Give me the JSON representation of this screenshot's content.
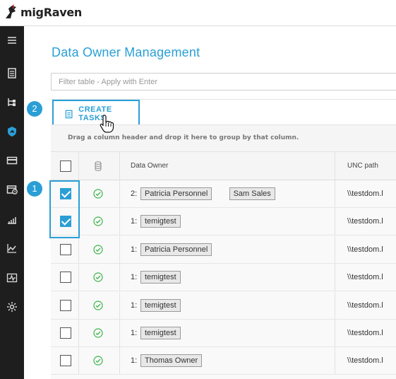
{
  "app": {
    "logo_text": "migRaven"
  },
  "sidebar": {
    "items": [
      {
        "icon": "menu-icon"
      },
      {
        "icon": "clipboard-icon"
      },
      {
        "icon": "tree-icon"
      },
      {
        "icon": "raven-shield-icon",
        "active": true
      },
      {
        "icon": "card-icon"
      },
      {
        "icon": "calendar-clock-icon"
      },
      {
        "icon": "bar-chart-icon"
      },
      {
        "icon": "line-chart-icon"
      },
      {
        "icon": "pulse-icon"
      },
      {
        "icon": "gear-icon"
      }
    ]
  },
  "main": {
    "title": "Data Owner Management",
    "filter_placeholder": "Filter table - Apply with Enter",
    "create_tasks_label": "CREATE TASKS",
    "group_hint": "Drag a column header and drop it here to group by that column.",
    "columns": {
      "owner": "Data Owner",
      "unc": "UNC path"
    },
    "rows": [
      {
        "checked": true,
        "count": "2:",
        "owners": [
          "Patricia Personnel",
          "Sam Sales"
        ],
        "unc": "\\\\testdom.l"
      },
      {
        "checked": true,
        "count": "1:",
        "owners": [
          "temigtest"
        ],
        "unc": "\\\\testdom.l"
      },
      {
        "checked": false,
        "count": "1:",
        "owners": [
          "Patricia Personnel"
        ],
        "unc": "\\\\testdom.l"
      },
      {
        "checked": false,
        "count": "1:",
        "owners": [
          "temigtest"
        ],
        "unc": "\\\\testdom.l"
      },
      {
        "checked": false,
        "count": "1:",
        "owners": [
          "temigtest"
        ],
        "unc": "\\\\testdom.l"
      },
      {
        "checked": false,
        "count": "1:",
        "owners": [
          "temigtest"
        ],
        "unc": "\\\\testdom.l"
      },
      {
        "checked": false,
        "count": "1:",
        "owners": [
          "Thomas Owner"
        ],
        "unc": "\\\\testdom.l"
      }
    ]
  },
  "callouts": {
    "one": "1",
    "two": "2"
  },
  "colors": {
    "accent": "#2a9fd6",
    "sidebar": "#1e1e1e",
    "ok": "#3cb44b"
  }
}
